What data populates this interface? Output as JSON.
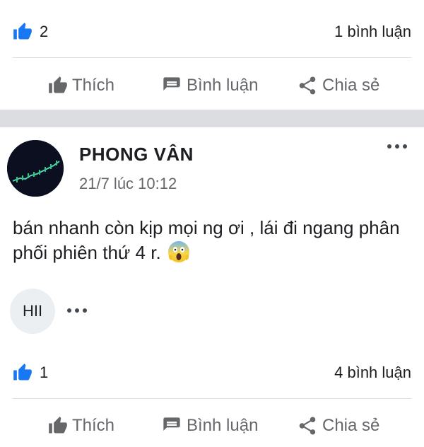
{
  "post1": {
    "like_count": "2",
    "comment_count": "1 bình luận",
    "actions": {
      "like": "Thích",
      "comment": "Bình luận",
      "share": "Chia sẻ"
    }
  },
  "post2": {
    "author": "PHONG VÂN",
    "time": "21/7 lúc 10:12",
    "text": "bán nhanh còn kịp mọi ng ơi , lái đi ngang phân phối phiên thứ 4 r.",
    "emoji": "screaming-face-emoji",
    "reactor": "HII",
    "like_count": "1",
    "comment_count": "4 bình luận",
    "actions": {
      "like": "Thích",
      "comment": "Bình luận",
      "share": "Chia sẻ"
    }
  },
  "colors": {
    "brand_blue": "#1877f2",
    "muted_text": "#65676b",
    "separator": "#dcdde0"
  },
  "icons": [
    "thumbs-up-badge-icon",
    "like-icon",
    "comment-icon",
    "share-icon",
    "more-options-icon"
  ]
}
